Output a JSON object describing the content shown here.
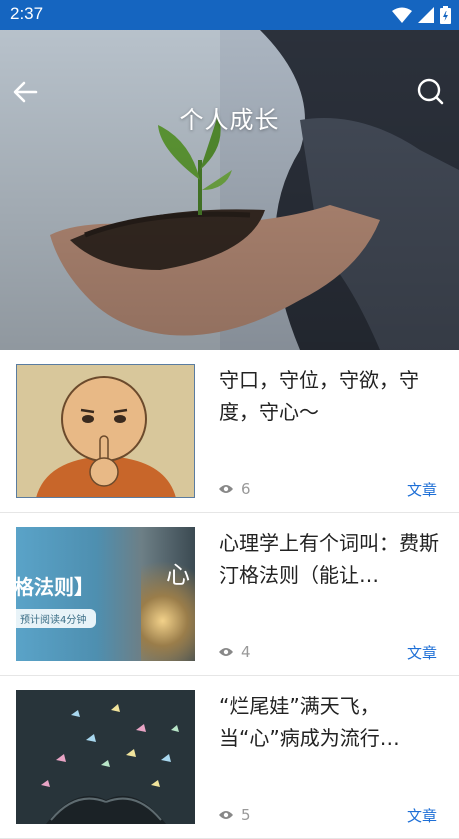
{
  "status": {
    "time": "2:37"
  },
  "header": {
    "title": "个人成长"
  },
  "articles": [
    {
      "title": "守口，守位，守欲，守度，守心～",
      "views": "6",
      "tag": "文章"
    },
    {
      "title": "心理学上有个词叫：费斯汀格法则（能让…",
      "views": "4",
      "tag": "文章",
      "thumb_text": "格法则】",
      "thumb_sub": "预计阅读4分钟",
      "thumb_char": "心"
    },
    {
      "title": "“烂尾娃”满天飞，当“心”病成为流行病，…",
      "views": "5",
      "tag": "文章"
    }
  ],
  "colors": {
    "status_bar": "#1565c0",
    "accent": "#1e6fd6"
  }
}
